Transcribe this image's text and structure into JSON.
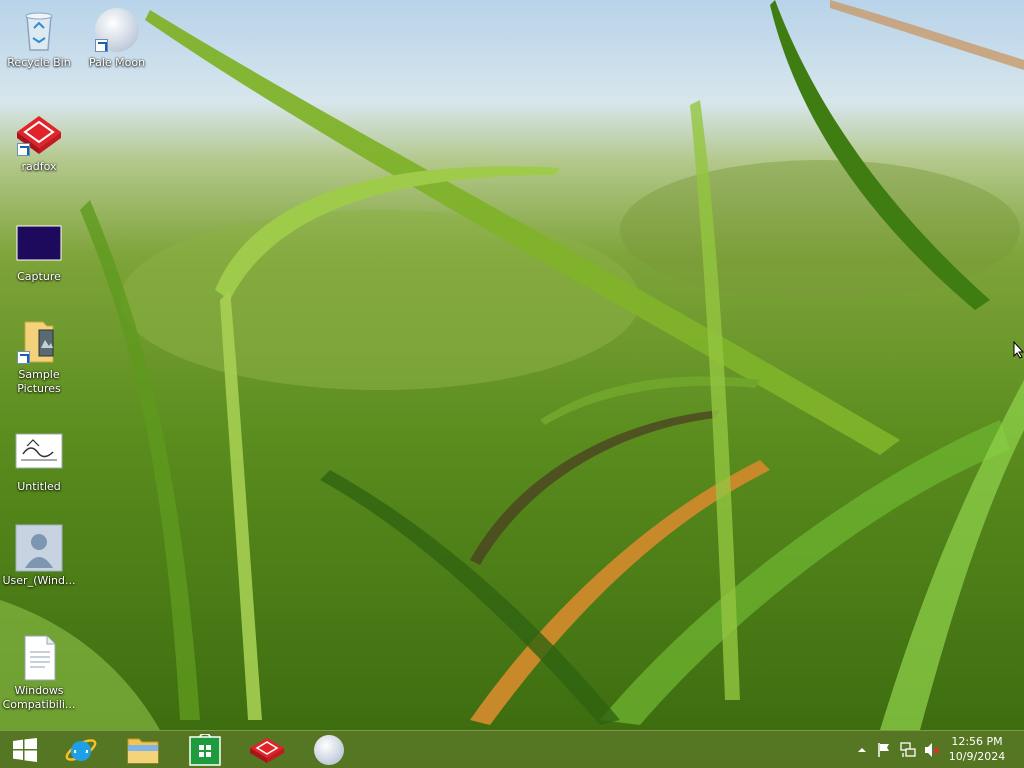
{
  "desktop": {
    "icons": [
      {
        "label": "Recycle Bin",
        "icon": "recycle-bin-icon"
      },
      {
        "label": "Pale Moon",
        "icon": "pale-moon-icon"
      },
      {
        "label": "radfox",
        "icon": "radfox-icon"
      },
      {
        "label": "Capture",
        "icon": "capture-image-icon"
      },
      {
        "label": "Sample Pictures",
        "icon": "folder-icon"
      },
      {
        "label": "Untitled",
        "icon": "paint-image-icon"
      },
      {
        "label": "User_(Wind...",
        "icon": "user-icon"
      },
      {
        "label": "Windows Compatibili...",
        "icon": "document-icon"
      }
    ]
  },
  "taskbar": {
    "start": {
      "icon": "windows-start-icon"
    },
    "pinned": [
      {
        "name": "Internet Explorer",
        "icon": "internet-explorer-icon"
      },
      {
        "name": "File Explorer",
        "icon": "file-explorer-icon"
      },
      {
        "name": "Store",
        "icon": "store-icon"
      },
      {
        "name": "radfox",
        "icon": "radfox-icon"
      },
      {
        "name": "Pale Moon",
        "icon": "pale-moon-icon"
      }
    ],
    "tray": {
      "icons": [
        "show-hidden-icons-chevron",
        "action-center-flag-icon",
        "network-icon",
        "volume-muted-icon"
      ],
      "time": "12:56 PM",
      "date": "10/9/2024"
    }
  },
  "colors": {
    "taskbar": "#5c7828",
    "store_green": "#1e9b3c",
    "ie_blue": "#1ea0e6",
    "radfox_red": "#e0242a"
  }
}
